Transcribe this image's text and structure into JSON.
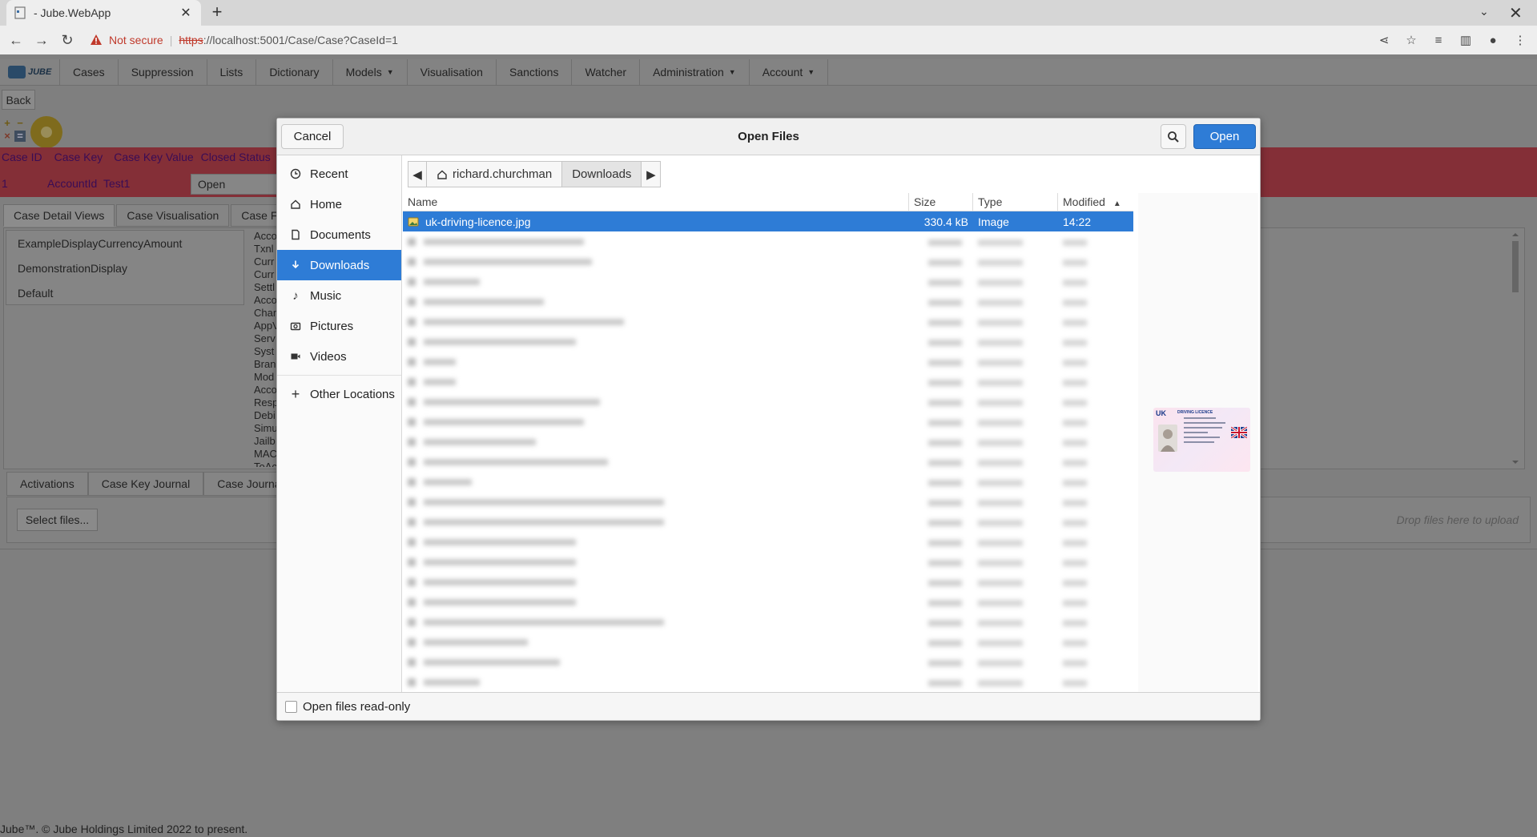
{
  "browser": {
    "tab_title": "- Jube.WebApp",
    "not_secure": "Not secure",
    "url_scheme": "https",
    "url_rest": "://localhost:5001/Case/Case?CaseId=1"
  },
  "app": {
    "logo_text": "JUBE",
    "menu": [
      {
        "label": "Cases",
        "caret": false
      },
      {
        "label": "Suppression",
        "caret": false
      },
      {
        "label": "Lists",
        "caret": false
      },
      {
        "label": "Dictionary",
        "caret": false
      },
      {
        "label": "Models",
        "caret": true
      },
      {
        "label": "Visualisation",
        "caret": false
      },
      {
        "label": "Sanctions",
        "caret": false
      },
      {
        "label": "Watcher",
        "caret": false
      },
      {
        "label": "Administration",
        "caret": true
      },
      {
        "label": "Account",
        "caret": true
      }
    ],
    "back_label": "Back",
    "case_header": {
      "columns": [
        "Case ID",
        "Case Key",
        "Case Key Value",
        "Closed Status"
      ],
      "values": {
        "case_id": "1",
        "case_key": "AccountId",
        "case_key_value": "Test1",
        "status": "Open"
      }
    },
    "detail_tabs": [
      "Case Detail Views",
      "Case Visualisation",
      "Case F"
    ],
    "views": [
      "ExampleDisplayCurrencyAmount",
      "DemonstrationDisplay",
      "Default"
    ],
    "field_fragments": [
      "Acco",
      "Txnl",
      "Curr",
      "Curr",
      "Settl",
      "Acco",
      "Chan",
      "AppV",
      "Serv",
      "Syst",
      "Bran",
      "Mod",
      "Acco",
      "Resp",
      "Debi",
      "Simu",
      "Jailb",
      "MAC",
      "ToAc"
    ],
    "bottom_tabs": [
      "Activations",
      "Case Key Journal",
      "Case Journal"
    ],
    "select_files_label": "Select files...",
    "drop_hint": "Drop files here to upload",
    "footer": "Jube™. © Jube Holdings Limited 2022 to present."
  },
  "dialog": {
    "title": "Open Files",
    "cancel_label": "Cancel",
    "open_label": "Open",
    "sidebar": [
      {
        "label": "Recent",
        "icon": "clock-icon"
      },
      {
        "label": "Home",
        "icon": "home-icon"
      },
      {
        "label": "Documents",
        "icon": "document-icon"
      },
      {
        "label": "Downloads",
        "icon": "download-icon",
        "active": true
      },
      {
        "label": "Music",
        "icon": "music-icon"
      },
      {
        "label": "Pictures",
        "icon": "camera-icon"
      },
      {
        "label": "Videos",
        "icon": "video-icon"
      },
      {
        "label": "Other Locations",
        "icon": "plus-icon"
      }
    ],
    "path": {
      "home": "richard.churchman",
      "current": "Downloads"
    },
    "columns": {
      "name": "Name",
      "size": "Size",
      "type": "Type",
      "modified": "Modified"
    },
    "files": [
      {
        "name": "uk-driving-licence.jpg",
        "size": "330.4 kB",
        "type": "Image",
        "modified": "14:22",
        "selected": true,
        "icon": "image-icon"
      }
    ],
    "readonly_label": "Open files read-only"
  }
}
